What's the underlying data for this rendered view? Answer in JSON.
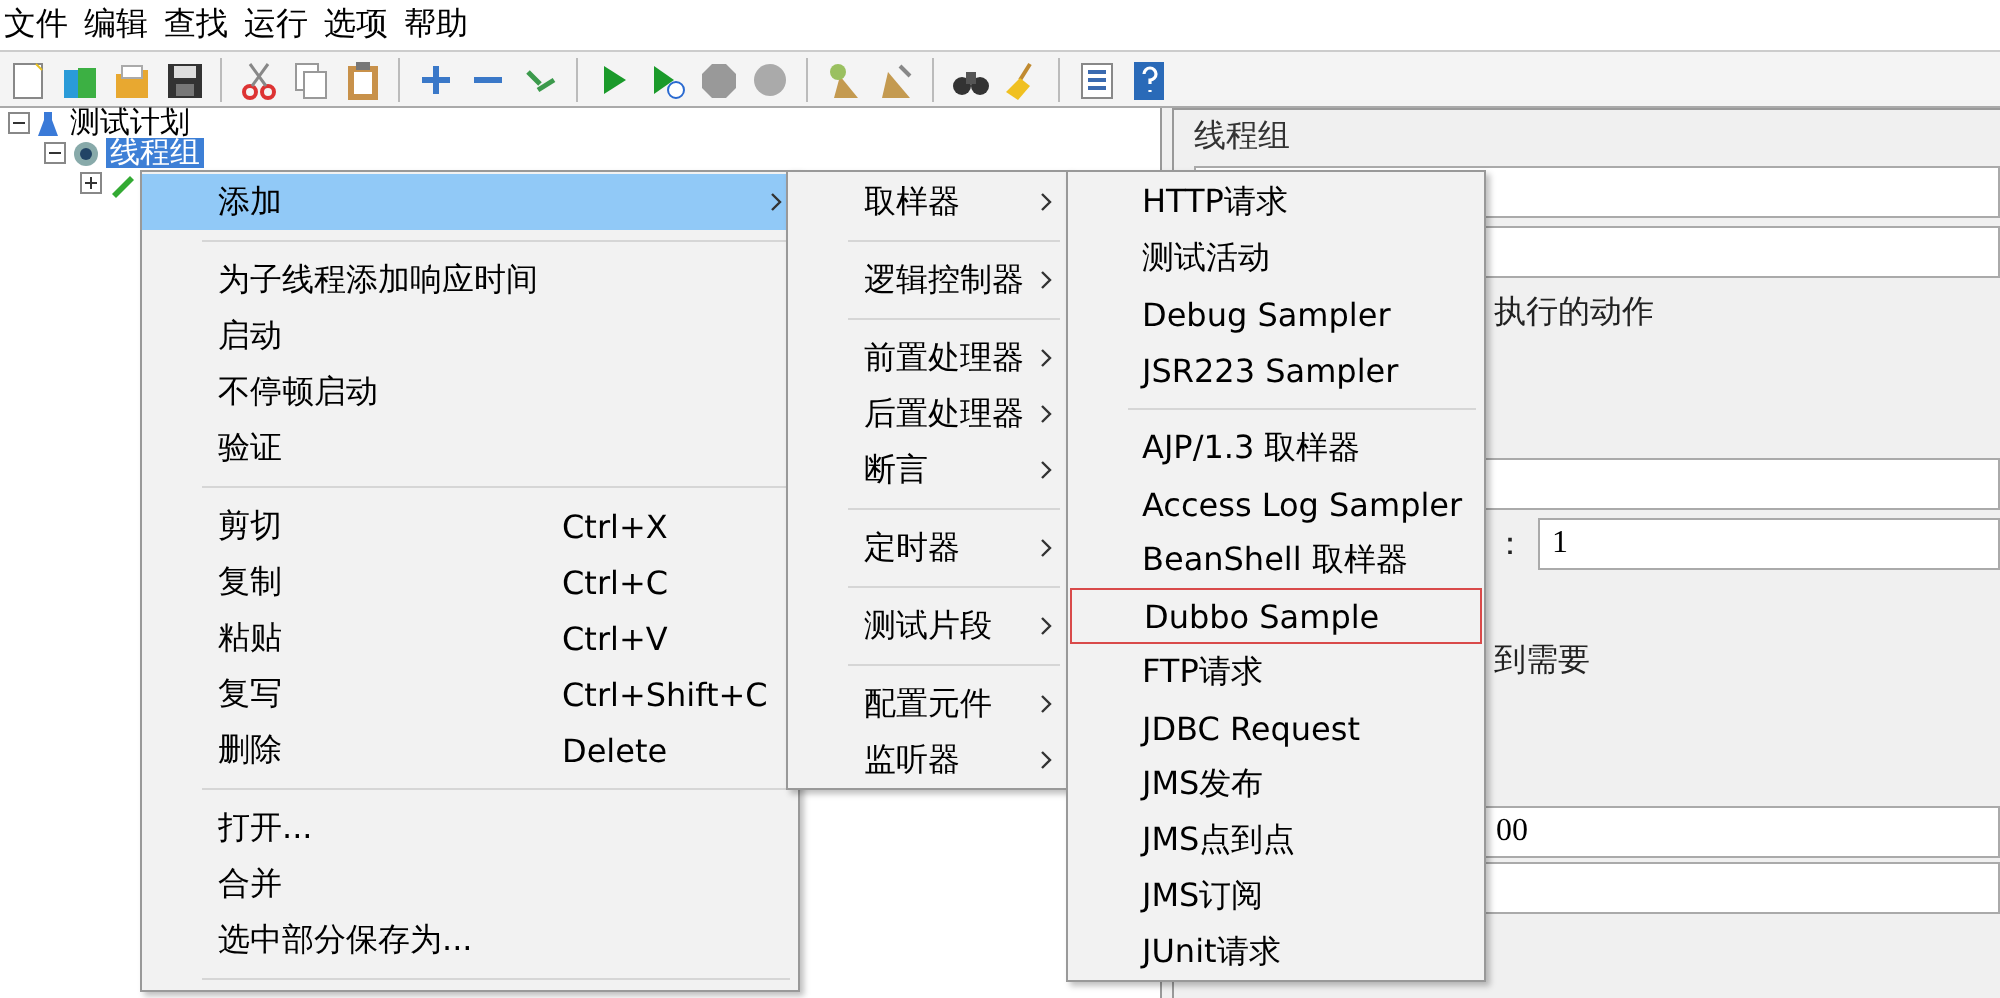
{
  "menubar": [
    "文件",
    "编辑",
    "查找",
    "运行",
    "选项",
    "帮助"
  ],
  "tree": [
    {
      "label": "测试计划",
      "expanded": true,
      "selected": false,
      "children": [
        {
          "label": "线程组",
          "expanded": true,
          "selected": true,
          "children": [
            {
              "expanded": false
            }
          ]
        }
      ]
    }
  ],
  "context_menu": [
    {
      "kind": "item",
      "label": "添加",
      "selected": true,
      "submenu": true
    },
    {
      "kind": "separator"
    },
    {
      "kind": "item",
      "label": "为子线程添加响应时间",
      "selected": false,
      "submenu": false
    },
    {
      "kind": "item",
      "label": "启动",
      "selected": false,
      "submenu": false
    },
    {
      "kind": "item",
      "label": "不停顿启动",
      "selected": false,
      "submenu": false
    },
    {
      "kind": "item",
      "label": "验证",
      "selected": false,
      "submenu": false
    },
    {
      "kind": "separator"
    },
    {
      "kind": "item",
      "label": "剪切",
      "shortcut": "Ctrl+X",
      "selected": false,
      "submenu": false
    },
    {
      "kind": "item",
      "label": "复制",
      "shortcut": "Ctrl+C",
      "selected": false,
      "submenu": false
    },
    {
      "kind": "item",
      "label": "粘贴",
      "shortcut": "Ctrl+V",
      "selected": false,
      "submenu": false
    },
    {
      "kind": "item",
      "label": "复写",
      "shortcut": "Ctrl+Shift+C",
      "selected": false,
      "submenu": false
    },
    {
      "kind": "item",
      "label": "删除",
      "shortcut": "Delete",
      "selected": false,
      "submenu": false
    },
    {
      "kind": "separator"
    },
    {
      "kind": "item",
      "label": "打开...",
      "selected": false,
      "submenu": false
    },
    {
      "kind": "item",
      "label": "合并",
      "selected": false,
      "submenu": false
    },
    {
      "kind": "item",
      "label": "选中部分保存为...",
      "selected": false,
      "submenu": false
    },
    {
      "kind": "separator"
    }
  ],
  "add_submenu": [
    {
      "kind": "item",
      "label": "取样器",
      "selected": false,
      "submenu": true
    },
    {
      "kind": "separator"
    },
    {
      "kind": "item",
      "label": "逻辑控制器",
      "selected": false,
      "submenu": true
    },
    {
      "kind": "separator"
    },
    {
      "kind": "item",
      "label": "前置处理器",
      "selected": false,
      "submenu": true
    },
    {
      "kind": "item",
      "label": "后置处理器",
      "selected": false,
      "submenu": true
    },
    {
      "kind": "item",
      "label": "断言",
      "selected": false,
      "submenu": true
    },
    {
      "kind": "separator"
    },
    {
      "kind": "item",
      "label": "定时器",
      "selected": false,
      "submenu": true
    },
    {
      "kind": "separator"
    },
    {
      "kind": "item",
      "label": "测试片段",
      "selected": false,
      "submenu": true
    },
    {
      "kind": "separator"
    },
    {
      "kind": "item",
      "label": "配置元件",
      "selected": false,
      "submenu": true
    },
    {
      "kind": "item",
      "label": "监听器",
      "selected": false,
      "submenu": true
    }
  ],
  "sampler_submenu": [
    {
      "kind": "item",
      "label": "HTTP请求",
      "outlined": false
    },
    {
      "kind": "item",
      "label": "测试活动",
      "outlined": false
    },
    {
      "kind": "item",
      "label": "Debug Sampler",
      "outlined": false
    },
    {
      "kind": "item",
      "label": "JSR223 Sampler",
      "outlined": false
    },
    {
      "kind": "separator"
    },
    {
      "kind": "item",
      "label": "AJP/1.3 取样器",
      "outlined": false
    },
    {
      "kind": "item",
      "label": "Access Log Sampler",
      "outlined": false
    },
    {
      "kind": "item",
      "label": "BeanShell 取样器",
      "outlined": false
    },
    {
      "kind": "item",
      "label": "Dubbo Sample",
      "outlined": true
    },
    {
      "kind": "item",
      "label": "FTP请求",
      "outlined": false
    },
    {
      "kind": "item",
      "label": "JDBC Request",
      "outlined": false
    },
    {
      "kind": "item",
      "label": "JMS发布",
      "outlined": false
    },
    {
      "kind": "item",
      "label": "JMS点到点",
      "outlined": false
    },
    {
      "kind": "item",
      "label": "JMS订阅",
      "outlined": false
    },
    {
      "kind": "item",
      "label": "JUnit请求",
      "outlined": false
    }
  ],
  "panel": {
    "title": "线程组",
    "action_label": "执行的动作",
    "count_label": "：",
    "count_value": "1",
    "delay_label": "到需要",
    "duration_value": "00"
  }
}
